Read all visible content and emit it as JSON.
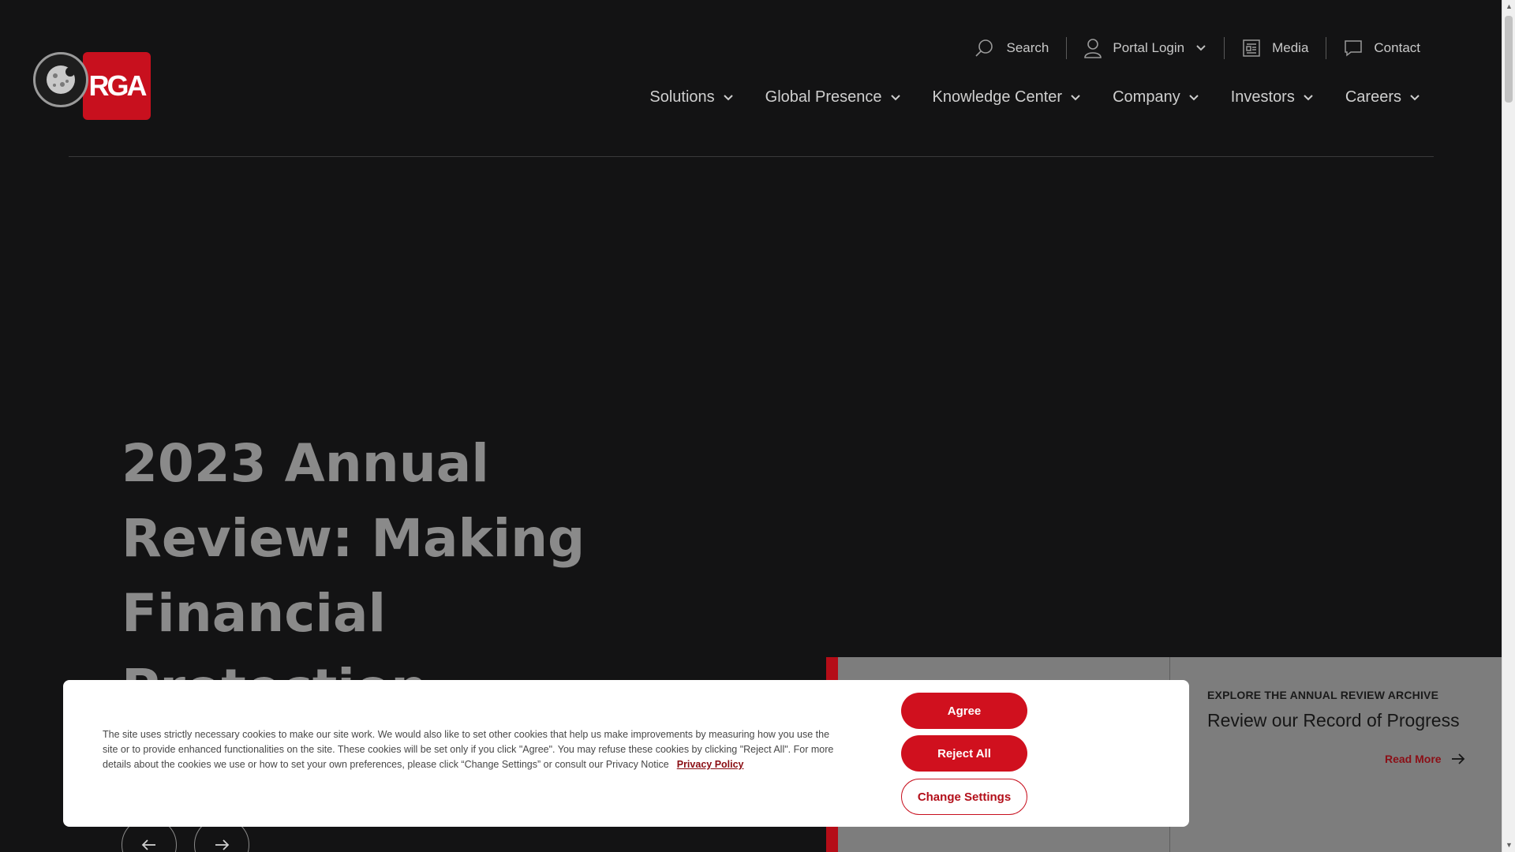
{
  "brand": {
    "logo_text": "RGA",
    "accent": "#c8101e"
  },
  "utility_nav": [
    {
      "label": "Search",
      "icon": "search-icon"
    },
    {
      "label": "Portal Login",
      "icon": "user-icon",
      "has_dropdown": true
    },
    {
      "label": "Media",
      "icon": "newspaper-icon"
    },
    {
      "label": "Contact",
      "icon": "chat-icon"
    }
  ],
  "main_nav": [
    {
      "label": "Solutions"
    },
    {
      "label": "Global Presence"
    },
    {
      "label": "Knowledge Center"
    },
    {
      "label": "Company"
    },
    {
      "label": "Investors"
    },
    {
      "label": "Careers"
    }
  ],
  "hero": {
    "title": "2023 Annual Review: Making Financial Protection"
  },
  "carousel": {
    "prev_icon": "arrow-left-icon",
    "next_icon": "arrow-right-icon"
  },
  "promo": {
    "eyebrow": "EXPLORE THE ANNUAL REVIEW ARCHIVE",
    "heading": "Review our Record of Progress",
    "link_label": "Read More"
  },
  "cookie_banner": {
    "text": "The site uses strictly necessary cookies to make our site work. We would also like to set other cookies that help us make improvements by measuring how you use the site or to provide enhanced functionalities on the site. These cookies will be set only if you click \"Agree\". You may refuse these cookies by clicking \"Reject All\". For more details about the cookies we use or how to set your own preferences, please click “Change Settings” or consult our Privacy Notice",
    "privacy_link": "Privacy Policy",
    "agree_label": "Agree",
    "reject_label": "Reject All",
    "settings_label": "Change Settings",
    "badge_icon": "cookie-icon"
  }
}
